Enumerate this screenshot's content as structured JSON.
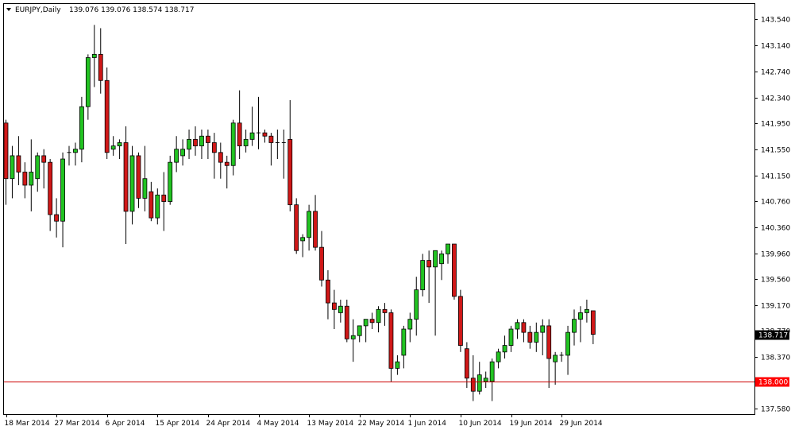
{
  "chart_data": {
    "type": "candlestick",
    "symbol_label": "EURJPY,Daily",
    "ohlc_label": "139.076 139.076 138.574 138.717",
    "current_price_label": "138.717",
    "current_price": 138.717,
    "hline_label": "138.000",
    "hline_value": 138.0,
    "ylim": [
      137.5,
      143.77
    ],
    "y_ticks": [
      "143.540",
      "143.140",
      "142.740",
      "142.340",
      "141.950",
      "141.550",
      "141.150",
      "140.760",
      "140.360",
      "139.960",
      "139.560",
      "139.170",
      "138.770",
      "138.370",
      "137.580"
    ],
    "x_labels": [
      {
        "label": "18 Mar 2014",
        "index": 0
      },
      {
        "label": "27 Mar 2014",
        "index": 8
      },
      {
        "label": "6 Apr 2014",
        "index": 16
      },
      {
        "label": "15 Apr 2014",
        "index": 24
      },
      {
        "label": "24 Apr 2014",
        "index": 32
      },
      {
        "label": "4 May 2014",
        "index": 40
      },
      {
        "label": "13 May 2014",
        "index": 48
      },
      {
        "label": "22 May 2014",
        "index": 56
      },
      {
        "label": "1 Jun 2014",
        "index": 64
      },
      {
        "label": "10 Jun 2014",
        "index": 72
      },
      {
        "label": "19 Jun 2014",
        "index": 80
      },
      {
        "label": "29 Jun 2014",
        "index": 88
      }
    ],
    "candles": [
      [
        141.95,
        142.0,
        140.7,
        141.1
      ],
      [
        141.1,
        141.6,
        140.8,
        141.45
      ],
      [
        141.45,
        141.75,
        141.0,
        141.2
      ],
      [
        141.2,
        141.35,
        140.8,
        141.0
      ],
      [
        141.0,
        141.7,
        140.6,
        141.2
      ],
      [
        141.1,
        141.5,
        140.9,
        141.45
      ],
      [
        141.45,
        141.55,
        140.95,
        141.35
      ],
      [
        141.35,
        141.4,
        140.3,
        140.55
      ],
      [
        140.55,
        140.8,
        140.2,
        140.45
      ],
      [
        140.45,
        141.5,
        140.05,
        141.4
      ],
      [
        141.5,
        141.6,
        141.3,
        141.5
      ],
      [
        141.5,
        141.65,
        141.3,
        141.55
      ],
      [
        141.55,
        142.35,
        141.35,
        142.2
      ],
      [
        142.2,
        143.0,
        142.0,
        142.95
      ],
      [
        142.95,
        143.45,
        142.5,
        143.0
      ],
      [
        143.0,
        143.4,
        142.4,
        142.6
      ],
      [
        142.6,
        142.8,
        141.4,
        141.5
      ],
      [
        141.55,
        141.75,
        141.45,
        141.6
      ],
      [
        141.6,
        141.7,
        141.4,
        141.65
      ],
      [
        141.65,
        141.9,
        140.1,
        140.6
      ],
      [
        140.6,
        141.6,
        140.4,
        141.45
      ],
      [
        141.45,
        141.5,
        140.65,
        140.8
      ],
      [
        140.8,
        141.6,
        140.6,
        141.1
      ],
      [
        140.9,
        141.05,
        140.45,
        140.5
      ],
      [
        140.5,
        140.95,
        140.4,
        140.85
      ],
      [
        140.85,
        141.2,
        140.3,
        140.75
      ],
      [
        140.75,
        141.45,
        140.7,
        141.35
      ],
      [
        141.35,
        141.75,
        141.2,
        141.55
      ],
      [
        141.45,
        141.7,
        141.3,
        141.55
      ],
      [
        141.55,
        141.85,
        141.4,
        141.7
      ],
      [
        141.7,
        141.9,
        141.45,
        141.6
      ],
      [
        141.6,
        141.85,
        141.4,
        141.75
      ],
      [
        141.75,
        141.85,
        141.4,
        141.65
      ],
      [
        141.65,
        141.8,
        141.1,
        141.5
      ],
      [
        141.5,
        141.65,
        141.1,
        141.35
      ],
      [
        141.35,
        141.45,
        140.95,
        141.3
      ],
      [
        141.3,
        142.0,
        141.15,
        141.95
      ],
      [
        141.95,
        142.45,
        141.4,
        141.6
      ],
      [
        141.6,
        141.85,
        141.5,
        141.7
      ],
      [
        141.7,
        142.2,
        141.6,
        141.8
      ],
      [
        141.8,
        142.35,
        141.55,
        141.8
      ],
      [
        141.8,
        141.85,
        141.65,
        141.75
      ],
      [
        141.75,
        141.8,
        141.3,
        141.65
      ],
      [
        141.65,
        141.85,
        141.4,
        141.65
      ],
      [
        141.65,
        141.85,
        141.1,
        141.65
      ],
      [
        141.7,
        142.3,
        140.6,
        140.7
      ],
      [
        140.7,
        140.8,
        139.95,
        140.0
      ],
      [
        140.15,
        140.25,
        139.9,
        140.2
      ],
      [
        140.2,
        140.7,
        140.0,
        140.6
      ],
      [
        140.6,
        140.85,
        140.0,
        140.05
      ],
      [
        140.05,
        140.3,
        139.45,
        139.55
      ],
      [
        139.55,
        139.7,
        138.95,
        139.2
      ],
      [
        139.2,
        139.4,
        138.8,
        139.1
      ],
      [
        139.05,
        139.25,
        138.9,
        139.15
      ],
      [
        139.15,
        139.25,
        138.6,
        138.65
      ],
      [
        138.65,
        138.95,
        138.3,
        138.7
      ],
      [
        138.7,
        138.85,
        138.6,
        138.85
      ],
      [
        138.85,
        138.95,
        138.6,
        138.95
      ],
      [
        138.95,
        139.05,
        138.8,
        138.9
      ],
      [
        138.9,
        139.15,
        138.75,
        139.1
      ],
      [
        139.1,
        139.2,
        138.85,
        139.05
      ],
      [
        139.05,
        139.1,
        138.0,
        138.2
      ],
      [
        138.2,
        138.4,
        138.1,
        138.3
      ],
      [
        138.4,
        138.85,
        138.2,
        138.8
      ],
      [
        138.8,
        139.05,
        138.6,
        138.95
      ],
      [
        138.95,
        139.6,
        138.7,
        139.4
      ],
      [
        139.4,
        139.95,
        139.3,
        139.85
      ],
      [
        139.85,
        140.0,
        139.2,
        139.75
      ],
      [
        139.75,
        140.0,
        138.7,
        140.0
      ],
      [
        139.8,
        140.0,
        139.55,
        139.95
      ],
      [
        139.95,
        140.1,
        139.8,
        140.1
      ],
      [
        140.1,
        140.1,
        139.25,
        139.3
      ],
      [
        139.3,
        139.4,
        138.45,
        138.55
      ],
      [
        138.5,
        138.6,
        137.9,
        138.05
      ],
      [
        138.05,
        138.4,
        137.7,
        137.85
      ],
      [
        137.85,
        138.3,
        137.8,
        138.1
      ],
      [
        138.0,
        138.15,
        137.9,
        138.05
      ],
      [
        138.0,
        138.35,
        137.7,
        138.3
      ],
      [
        138.3,
        138.5,
        138.2,
        138.45
      ],
      [
        138.45,
        138.7,
        138.35,
        138.55
      ],
      [
        138.55,
        138.85,
        138.45,
        138.8
      ],
      [
        138.8,
        138.95,
        138.65,
        138.9
      ],
      [
        138.9,
        138.95,
        138.6,
        138.75
      ],
      [
        138.75,
        138.85,
        138.5,
        138.6
      ],
      [
        138.6,
        138.9,
        138.45,
        138.75
      ],
      [
        138.75,
        138.95,
        138.4,
        138.85
      ],
      [
        138.85,
        138.95,
        137.9,
        138.35
      ],
      [
        138.3,
        138.45,
        137.95,
        138.4
      ],
      [
        138.4,
        138.45,
        138.3,
        138.4
      ],
      [
        138.4,
        138.85,
        138.1,
        138.75
      ],
      [
        138.75,
        139.1,
        138.55,
        138.95
      ],
      [
        138.95,
        139.15,
        138.6,
        139.05
      ],
      [
        139.05,
        139.25,
        138.9,
        139.1
      ],
      [
        139.08,
        139.08,
        138.57,
        138.72
      ]
    ]
  }
}
